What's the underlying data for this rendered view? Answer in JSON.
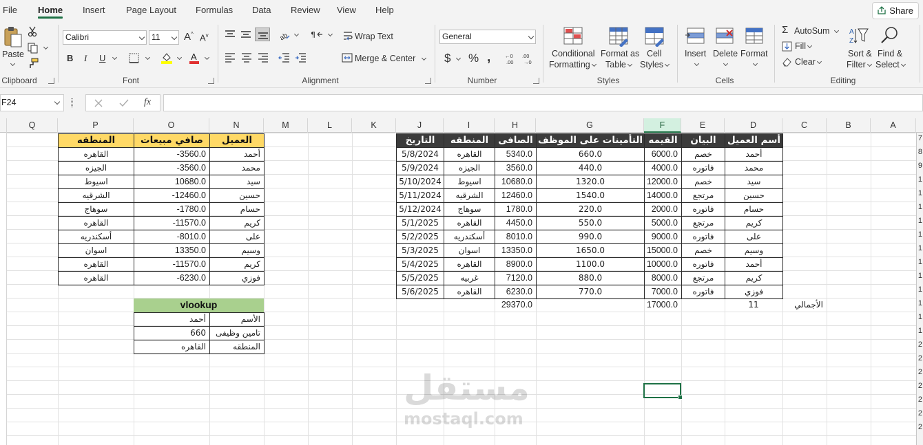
{
  "menu": {
    "tabs": [
      "File",
      "Home",
      "Insert",
      "Page Layout",
      "Formulas",
      "Data",
      "Review",
      "View",
      "Help"
    ],
    "active": "Home",
    "share": "Share"
  },
  "ribbon": {
    "clipboard": {
      "paste": "Paste",
      "label": "Clipboard"
    },
    "font": {
      "name": "Calibri",
      "size": "11",
      "label": "Font",
      "bold": "B",
      "italic": "I",
      "underline": "U"
    },
    "alignment": {
      "wrap_text": "Wrap Text",
      "merge_center": "Merge & Center",
      "label": "Alignment"
    },
    "number": {
      "format": "General",
      "label": "Number"
    },
    "styles": {
      "conditional_formatting_1": "Conditional",
      "conditional_formatting_2": "Formatting",
      "format_as_table_1": "Format as",
      "format_as_table_2": "Table",
      "cell_styles_1": "Cell",
      "cell_styles_2": "Styles",
      "label": "Styles"
    },
    "cells": {
      "insert": "Insert",
      "delete": "Delete",
      "format": "Format",
      "label": "Cells"
    },
    "editing": {
      "autosum": "AutoSum",
      "fill": "Fill",
      "clear": "Clear",
      "sort_filter_1": "Sort &",
      "sort_filter_2": "Filter",
      "find_select_1": "Find &",
      "find_select_2": "Select",
      "label": "Editing"
    }
  },
  "formula_bar": {
    "name_box": "F24",
    "fx": "fx",
    "content": ""
  },
  "grid": {
    "columns": [
      "Q",
      "P",
      "O",
      "N",
      "M",
      "L",
      "K",
      "J",
      "I",
      "H",
      "G",
      "F",
      "E",
      "D",
      "C",
      "B",
      "A"
    ],
    "selected_column": "F",
    "row_numbers": [
      "7",
      "8",
      "9",
      "1",
      "1",
      "1",
      "1",
      "1",
      "1",
      "1",
      "1",
      "1",
      "1",
      "1",
      "1",
      "2",
      "2",
      "2",
      "2",
      "2",
      "2",
      "2"
    ],
    "main_table": {
      "headers": [
        "أسم العميل",
        "البيان",
        "القيمه",
        "التأمينات على الموظف",
        "الصافى",
        "المنطقه",
        "التاريخ"
      ],
      "rows": [
        [
          "أحمد",
          "خصم",
          "6000.0",
          "660.0",
          "5340.0",
          "القاهره",
          "5/8/2024"
        ],
        [
          "محمد",
          "فاتوره",
          "4000.0",
          "440.0",
          "3560.0",
          "الجيزه",
          "5/9/2024"
        ],
        [
          "سيد",
          "خصم",
          "12000.0",
          "1320.0",
          "10680.0",
          "اسيوط",
          "5/10/2024"
        ],
        [
          "حسين",
          "مرتجع",
          "14000.0",
          "1540.0",
          "12460.0",
          "الشرقيه",
          "5/11/2024"
        ],
        [
          "حسام",
          "فاتوره",
          "2000.0",
          "220.0",
          "1780.0",
          "سوهاج",
          "5/12/2024"
        ],
        [
          "كريم",
          "مرتجع",
          "5000.0",
          "550.0",
          "4450.0",
          "القاهره",
          "5/1/2025"
        ],
        [
          "على",
          "فاتوره",
          "9000.0",
          "990.0",
          "8010.0",
          "أسكندريه",
          "5/2/2025"
        ],
        [
          "وسيم",
          "خصم",
          "15000.0",
          "1650.0",
          "13350.0",
          "اسوان",
          "5/3/2025"
        ],
        [
          "أحمد",
          "فاتوره",
          "10000.0",
          "1100.0",
          "8900.0",
          "القاهره",
          "5/4/2025"
        ],
        [
          "كريم",
          "مرتجع",
          "8000.0",
          "880.0",
          "7120.0",
          "غربيه",
          "5/5/2025"
        ],
        [
          "فوزي",
          "فاتوره",
          "7000.0",
          "770.0",
          "6230.0",
          "القاهره",
          "5/6/2025"
        ]
      ],
      "totals": {
        "label": "الأجمالي",
        "count": "11",
        "value": "17000.0",
        "net": "29370.0"
      }
    },
    "side_table": {
      "headers": [
        "العميل",
        "صافي مبيعات",
        "المنطقه"
      ],
      "rows": [
        [
          "أحمد",
          "-3560.0",
          "القاهره"
        ],
        [
          "محمد",
          "-3560.0",
          "الجيزه"
        ],
        [
          "سيد",
          "10680.0",
          "اسيوط"
        ],
        [
          "حسين",
          "-12460.0",
          "الشرقيه"
        ],
        [
          "حسام",
          "-1780.0",
          "سوهاج"
        ],
        [
          "كريم",
          "-11570.0",
          "القاهره"
        ],
        [
          "على",
          "-8010.0",
          "أسكندريه"
        ],
        [
          "وسيم",
          "13350.0",
          "اسوان"
        ],
        [
          "كريم",
          "-11570.0",
          "القاهره"
        ],
        [
          "فوزي",
          "-6230.0",
          "القاهره"
        ]
      ]
    },
    "vlookup": {
      "title": "vlookup",
      "rows": [
        [
          "الأسم",
          "أحمد"
        ],
        [
          "تامين وظيفى",
          "660"
        ],
        [
          "المنطقه",
          "القاهره"
        ]
      ]
    },
    "watermark": {
      "arabic": "مستقل",
      "latin": "mostaql.com"
    }
  }
}
